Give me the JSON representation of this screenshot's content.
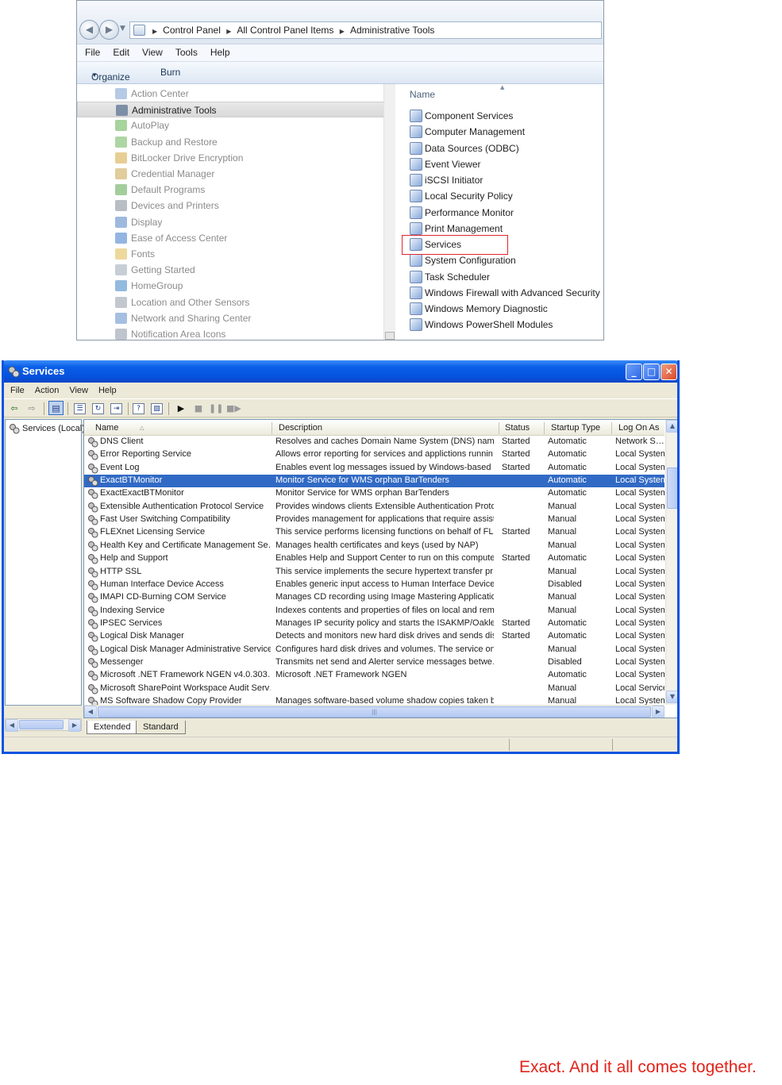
{
  "explorer": {
    "breadcrumb": [
      "Control Panel",
      "All Control Panel Items",
      "Administrative Tools"
    ],
    "menu": [
      "File",
      "Edit",
      "View",
      "Tools",
      "Help"
    ],
    "commands": {
      "organize": "Organize",
      "burn": "Burn"
    },
    "nav_items": [
      {
        "label": "Action Center",
        "icon": "flag-icon",
        "color": "#7a9fd1"
      },
      {
        "label": "Administrative Tools",
        "icon": "admin-tools-icon",
        "color": "#7d8fa6",
        "selected": true
      },
      {
        "label": "AutoPlay",
        "icon": "autoplay-icon",
        "color": "#5fae4d"
      },
      {
        "label": "Backup and Restore",
        "icon": "backup-icon",
        "color": "#6cb35a"
      },
      {
        "label": "BitLocker Drive Encryption",
        "icon": "key-icon",
        "color": "#d4a63c"
      },
      {
        "label": "Credential Manager",
        "icon": "vault-icon",
        "color": "#c9a24a"
      },
      {
        "label": "Default Programs",
        "icon": "default-programs-icon",
        "color": "#58a64a"
      },
      {
        "label": "Devices and Printers",
        "icon": "printer-icon",
        "color": "#7f8894"
      },
      {
        "label": "Display",
        "icon": "monitor-icon",
        "color": "#4f7fc2"
      },
      {
        "label": "Ease of Access Center",
        "icon": "accessibility-icon",
        "color": "#3d78c9"
      },
      {
        "label": "Fonts",
        "icon": "fonts-folder-icon",
        "color": "#e0b94a"
      },
      {
        "label": "Getting Started",
        "icon": "getting-started-icon",
        "color": "#9aa6b4"
      },
      {
        "label": "HomeGroup",
        "icon": "homegroup-icon",
        "color": "#3b82c4"
      },
      {
        "label": "Location and Other Sensors",
        "icon": "sensor-icon",
        "color": "#8f9aa6"
      },
      {
        "label": "Network and Sharing Center",
        "icon": "network-icon",
        "color": "#5b8ac9"
      },
      {
        "label": "Notification Area Icons",
        "icon": "notification-icon",
        "color": "#8a96a6"
      }
    ],
    "name_header": "Name",
    "tools": [
      "Component Services",
      "Computer Management",
      "Data Sources (ODBC)",
      "Event Viewer",
      "iSCSI Initiator",
      "Local Security Policy",
      "Performance Monitor",
      "Print Management",
      "Services",
      "System Configuration",
      "Task Scheduler",
      "Windows Firewall with Advanced Security",
      "Windows Memory Diagnostic",
      "Windows PowerShell Modules"
    ],
    "highlight_color": "#e0262e"
  },
  "services_window": {
    "title": "Services",
    "menu": [
      "File",
      "Action",
      "View",
      "Help"
    ],
    "tree_root": "Services (Local)",
    "columns": [
      "Name",
      "Description",
      "Status",
      "Startup Type",
      "Log On As"
    ],
    "rows": [
      {
        "name": "DNS Client",
        "desc": "Resolves and caches Domain Name System (DNS) names…",
        "status": "Started",
        "startup": "Automatic",
        "logon": "Network S…"
      },
      {
        "name": "Error Reporting Service",
        "desc": "Allows error reporting for services and applictions runnin…",
        "status": "Started",
        "startup": "Automatic",
        "logon": "Local System"
      },
      {
        "name": "Event Log",
        "desc": "Enables event log messages issued by Windows-based p…",
        "status": "Started",
        "startup": "Automatic",
        "logon": "Local System"
      },
      {
        "name": "ExactBTMonitor",
        "desc": "Monitor Service for WMS orphan BarTenders",
        "status": "",
        "startup": "Automatic",
        "logon": "Local System",
        "selected": true
      },
      {
        "name": "ExactExactBTMonitor",
        "desc": "Monitor Service for WMS orphan BarTenders",
        "status": "",
        "startup": "Automatic",
        "logon": "Local System"
      },
      {
        "name": "Extensible Authentication Protocol Service",
        "desc": "Provides windows clients Extensible Authentication Proto…",
        "status": "",
        "startup": "Manual",
        "logon": "Local System"
      },
      {
        "name": "Fast User Switching Compatibility",
        "desc": "Provides management for applications that require assist…",
        "status": "",
        "startup": "Manual",
        "logon": "Local System"
      },
      {
        "name": "FLEXnet Licensing Service",
        "desc": "This service performs licensing functions on behalf of FLE…",
        "status": "Started",
        "startup": "Manual",
        "logon": "Local System"
      },
      {
        "name": "Health Key and Certificate Management Se…",
        "desc": "Manages health certificates and keys (used by NAP)",
        "status": "",
        "startup": "Manual",
        "logon": "Local System"
      },
      {
        "name": "Help and Support",
        "desc": "Enables Help and Support Center to run on this compute…",
        "status": "Started",
        "startup": "Automatic",
        "logon": "Local System"
      },
      {
        "name": "HTTP SSL",
        "desc": "This service implements the secure hypertext transfer pr…",
        "status": "",
        "startup": "Manual",
        "logon": "Local System"
      },
      {
        "name": "Human Interface Device Access",
        "desc": "Enables generic input access to Human Interface Device…",
        "status": "",
        "startup": "Disabled",
        "logon": "Local System"
      },
      {
        "name": "IMAPI CD-Burning COM Service",
        "desc": "Manages CD recording using Image Mastering Applicatio…",
        "status": "",
        "startup": "Manual",
        "logon": "Local System"
      },
      {
        "name": "Indexing Service",
        "desc": "Indexes contents and properties of files on local and rem…",
        "status": "",
        "startup": "Manual",
        "logon": "Local System"
      },
      {
        "name": "IPSEC Services",
        "desc": "Manages IP security policy and starts the ISAKMP/Oakle…",
        "status": "Started",
        "startup": "Automatic",
        "logon": "Local System"
      },
      {
        "name": "Logical Disk Manager",
        "desc": "Detects and monitors new hard disk drives and sends dis…",
        "status": "Started",
        "startup": "Automatic",
        "logon": "Local System"
      },
      {
        "name": "Logical Disk Manager Administrative Service",
        "desc": "Configures hard disk drives and volumes. The service onl…",
        "status": "",
        "startup": "Manual",
        "logon": "Local System"
      },
      {
        "name": "Messenger",
        "desc": "Transmits net send and Alerter service messages betwe…",
        "status": "",
        "startup": "Disabled",
        "logon": "Local System"
      },
      {
        "name": "Microsoft .NET Framework NGEN v4.0.303…",
        "desc": "Microsoft .NET Framework NGEN",
        "status": "",
        "startup": "Automatic",
        "logon": "Local System"
      },
      {
        "name": "Microsoft SharePoint Workspace Audit Serv…",
        "desc": "",
        "status": "",
        "startup": "Manual",
        "logon": "Local Service"
      },
      {
        "name": "MS Software Shadow Copy Provider",
        "desc": "Manages software-based volume shadow copies taken b…",
        "status": "",
        "startup": "Manual",
        "logon": "Local System"
      }
    ],
    "tabs": [
      "Extended",
      "Standard"
    ],
    "title_bar_color": "#0a5fe8",
    "selection_color": "#316ac5"
  },
  "tagline": "Exact. And it all comes together.",
  "tagline_color": "#e2231a"
}
